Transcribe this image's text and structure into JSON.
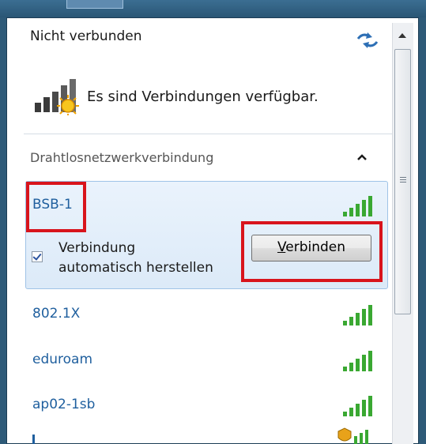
{
  "header": {
    "status": "Nicht verbunden",
    "availability": "Es sind Verbindungen verfügbar."
  },
  "section": {
    "title": "Drahtlosnetzwerkverbindung"
  },
  "selected_network": {
    "name": "BSB-1",
    "auto_connect_line1": "Verbindung",
    "auto_connect_line2": "automatisch herstellen",
    "auto_connect_checked": true,
    "connect_button_first": "V",
    "connect_button_rest": "erbinden"
  },
  "networks": [
    {
      "name": "802.1X"
    },
    {
      "name": "eduroam"
    },
    {
      "name": "ap02-1sb"
    }
  ],
  "colors": {
    "highlight": "#d8141c",
    "network_text": "#1f5f9e",
    "signal": "#3aa832"
  }
}
